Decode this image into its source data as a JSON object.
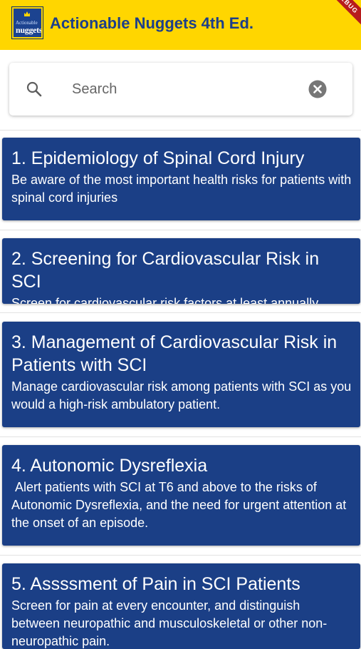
{
  "appbar": {
    "title": "Actionable Nuggets 4th Ed.",
    "logo_line1": "Actionable",
    "logo_line2": "nuggets",
    "debug_banner": "DEBUG"
  },
  "search": {
    "placeholder": "Search",
    "value": ""
  },
  "nuggets": [
    {
      "title": "1. Epidemiology of Spinal Cord Injury",
      "description": "Be aware of the most important health risks for patients with spinal cord injuries"
    },
    {
      "title": "2. Screening for Cardiovascular Risk in SCI",
      "description": "Screen for cardiovascular risk factors at least annually."
    },
    {
      "title": "3. Management of Cardiovascular Risk in Patients with SCI",
      "description": "Manage cardiovascular risk among patients with SCI as you would a high-risk ambulatory patient."
    },
    {
      "title": "4. Autonomic Dysreflexia",
      "description": " Alert patients with SCI at T6 and above to the risks of Autonomic Dysreflexia, and the need for urgent attention at the onset of an episode."
    },
    {
      "title": "5. Assssment of Pain in SCI Patients",
      "description": "Screen for pain at every encounter, and distinguish between neuropathic and musculoskeletal or other non-neuropathic pain."
    }
  ],
  "colors": {
    "appbar": "#ffd600",
    "title_text": "#1c3f8a",
    "card": "#1b3f86",
    "debug_ribbon": "#b71c1c"
  },
  "icons": {
    "search": "search-icon",
    "clear": "clear-icon",
    "logo": "app-logo"
  }
}
